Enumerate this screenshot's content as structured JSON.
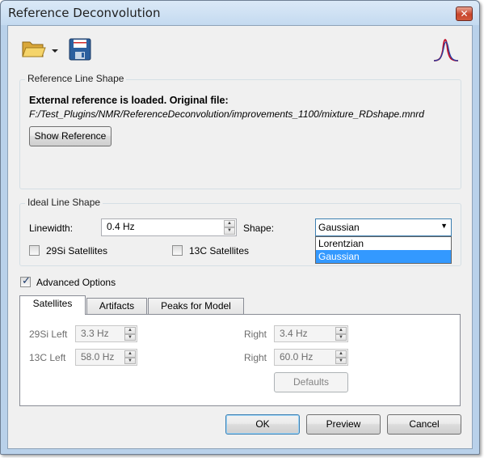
{
  "window": {
    "title": "Reference Deconvolution",
    "close_glyph": "✕"
  },
  "toolbar": {
    "open_icon": "folder-open-icon",
    "dropdown_icon": "dropdown-arrow-icon",
    "save_icon": "save-icon",
    "peak_icon": "peak-shape-icon"
  },
  "reference": {
    "group_label": "Reference Line Shape",
    "status": "External reference is loaded. Original file:",
    "file_path": "F:/Test_Plugins/NMR/ReferenceDeconvolution/improvements_1100/mixture_RDshape.mnrd",
    "show_button": "Show Reference"
  },
  "ideal": {
    "group_label": "Ideal Line Shape",
    "linewidth_label": "Linewidth:",
    "linewidth_value": "0.4 Hz",
    "shape_label": "Shape:",
    "shape_selected": "Gaussian",
    "shape_options": [
      "Lorentzian",
      "Gaussian"
    ],
    "si_label": "29Si Satellites",
    "c13_label": "13C Satellites",
    "si_checked": false,
    "c13_checked": false
  },
  "advanced": {
    "label": "Advanced Options",
    "checked": true
  },
  "tabs": [
    "Satellites",
    "Artifacts",
    "Peaks for Model"
  ],
  "satellites": {
    "si_left_label": "29Si Left",
    "si_left_value": "3.3 Hz",
    "si_right_label": "Right",
    "si_right_value": "3.4 Hz",
    "c_left_label": "13C Left",
    "c_left_value": "58.0 Hz",
    "c_right_label": "Right",
    "c_right_value": "60.0 Hz",
    "defaults_button": "Defaults"
  },
  "buttons": {
    "ok": "OK",
    "preview": "Preview",
    "cancel": "Cancel"
  },
  "colors": {
    "accent": "#3399ff",
    "title_bg": "#c4daf0",
    "peak_icon": "#c0102b"
  }
}
